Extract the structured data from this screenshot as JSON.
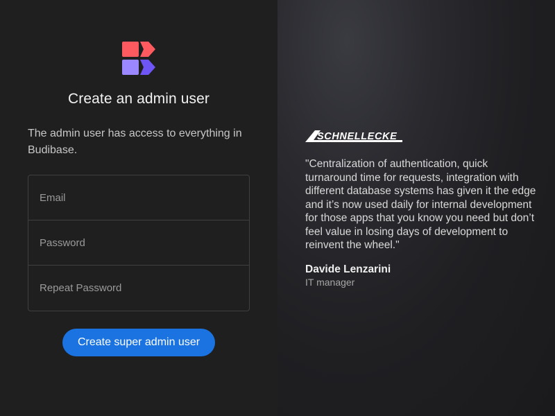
{
  "form": {
    "title": "Create an admin user",
    "description": "The admin user has access to everything in Budibase.",
    "email_placeholder": "Email",
    "email_value": "",
    "password_placeholder": "Password",
    "password_value": "",
    "repeat_password_placeholder": "Repeat Password",
    "repeat_password_value": "",
    "submit_label": "Create super admin user"
  },
  "testimonial": {
    "company_logo_text": "SCHNELLECKE",
    "quote_lines": [
      "\"Centralization of authentication, quick",
      "turnaround time for requests, integration with",
      "different database systems has given it the edge",
      "and it’s now used daily for internal development",
      "for those apps that you know you need but don’t",
      "feel value in losing days of development to",
      "reinvent the wheel.\""
    ],
    "author_name": "Davide Lenzarini",
    "author_role": "IT manager"
  },
  "colors": {
    "left_background": "#1f1f1f",
    "button_blue": "#1a73e0",
    "logo_coral": "#ff5a5f",
    "logo_purple": "#7c5cff"
  },
  "icons": {
    "logo": "budibase-logo-icon"
  }
}
